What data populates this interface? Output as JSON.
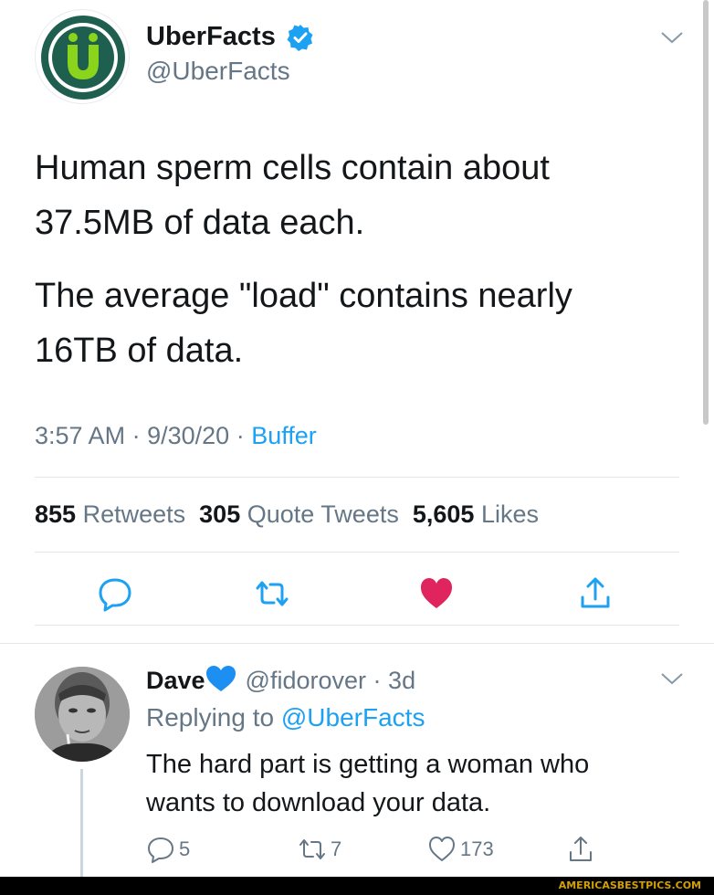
{
  "tweet": {
    "author_name": "UberFacts",
    "author_handle": "@UberFacts",
    "body_lines": [
      "Human sperm cells contain about",
      "37.5MB of data each.",
      "The average \"load\" contains nearly",
      "16TB of data."
    ],
    "time": "3:57 AM",
    "date": "9/30/20",
    "source": "Buffer",
    "separator": "·",
    "retweets_count": "855",
    "retweets_label": "Retweets",
    "quote_count": "305",
    "quote_label": "Quote Tweets",
    "likes_count": "5,605",
    "likes_label": "Likes",
    "icons": {
      "reply": "reply-icon",
      "retweet": "retweet-icon",
      "like": "heart-filled-icon",
      "share": "share-icon",
      "menu": "chevron-down-icon",
      "verified": "verified-badge-icon"
    },
    "colors": {
      "verified": "#1da1f2",
      "like": "#e0245e",
      "link": "#1da1f2",
      "avatar_bg": "#1f5f4f",
      "avatar_letter": "#8bd41c"
    }
  },
  "reply": {
    "author_name": "Dave",
    "name_emoji": "blue-heart-icon",
    "author_handle": "@fidorover",
    "age": "3d",
    "replying_label": "Replying to",
    "replying_handle": "@UberFacts",
    "text_lines": [
      "The hard part is getting a woman who",
      "wants to download your data."
    ],
    "reply_count": "5",
    "retweet_count": "7",
    "like_count": "173"
  },
  "watermark": "AMERICASBESTPICS.COM"
}
